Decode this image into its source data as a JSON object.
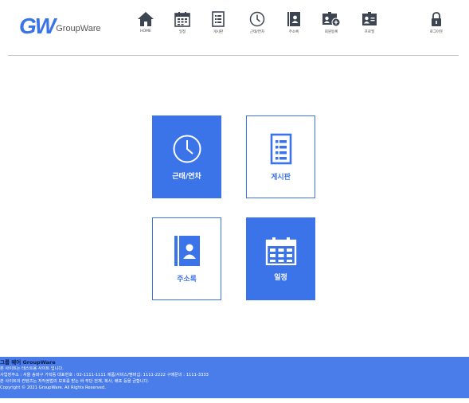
{
  "header": {
    "logo_mark": "GW",
    "logo_text": "GroupWare",
    "nav": [
      {
        "label": "HOME",
        "icon": "home-icon"
      },
      {
        "label": "일정",
        "icon": "calendar-icon"
      },
      {
        "label": "게시판",
        "icon": "board-icon"
      },
      {
        "label": "근태/연차",
        "icon": "clock-icon"
      },
      {
        "label": "주소록",
        "icon": "address-book-icon"
      },
      {
        "label": "회원등록",
        "icon": "add-member-icon"
      },
      {
        "label": "프로필",
        "icon": "profile-icon"
      },
      {
        "label": "로그아웃",
        "icon": "lock-icon"
      }
    ]
  },
  "tiles": [
    {
      "label": "근태/연차",
      "icon": "clock-icon",
      "style": "filled"
    },
    {
      "label": "게시판",
      "icon": "board-icon",
      "style": "outlined"
    },
    {
      "label": "주소록",
      "icon": "address-book-icon",
      "style": "outlined"
    },
    {
      "label": "일정",
      "icon": "calendar-icon",
      "style": "filled"
    }
  ],
  "footer": {
    "title": "그룹 웨어 GroupWare",
    "lines": [
      "본 사이트는 테스트용 사이트 입니다.",
      "사업장주소 : 서울 송파구 가락동 대표번호 : 02-1111-1111 제품/서비스/멤버십: 1111-2222 구매문의 : 1111-3333",
      "본 사이트의 컨텐츠는 저작권법의 보호를 받는 바 무단 전재, 복사, 배포 등을 금합니다.",
      "Copyright © 2021 GroupWare. All Rights Reserved."
    ]
  },
  "colors": {
    "accent": "#3b73e8",
    "footer_bg": "#4a7de9",
    "icon_dark": "#3d4452"
  }
}
